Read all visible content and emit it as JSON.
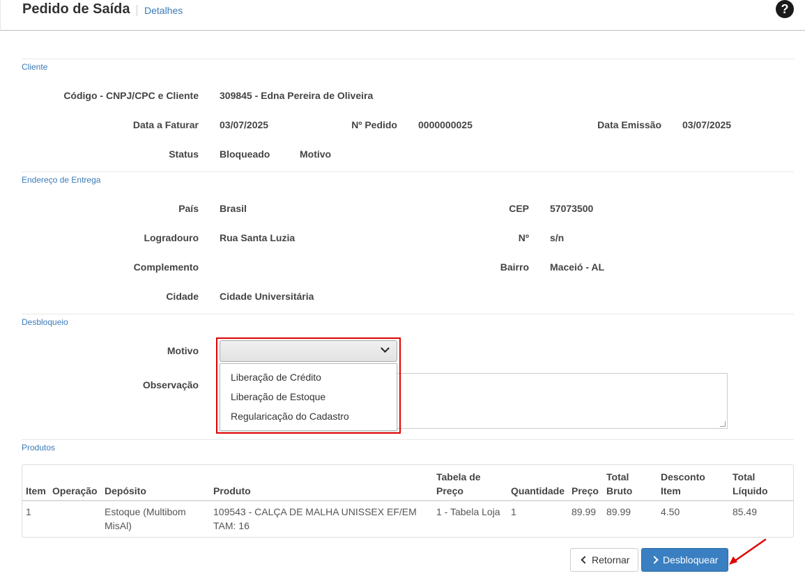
{
  "header": {
    "title": "Pedido de Saída",
    "breadcrumb": "Detalhes",
    "help_icon": "question-circle-icon"
  },
  "cliente": {
    "section_label": "Cliente",
    "codigo_label": "Código - CNPJ/CPC e Cliente",
    "codigo_value": "309845 - Edna Pereira de Oliveira",
    "data_faturar_label": "Data a Faturar",
    "data_faturar_value": "03/07/2025",
    "pedido_label": "Nº Pedido",
    "pedido_value": "0000000025",
    "data_emissao_label": "Data Emissão",
    "data_emissao_value": "03/07/2025",
    "status_label": "Status",
    "status_value": "Bloqueado",
    "motivo_label": "Motivo"
  },
  "endereco": {
    "section_label": "Endereço de Entrega",
    "pais_label": "País",
    "pais_value": "Brasil",
    "cep_label": "CEP",
    "cep_value": "57073500",
    "logradouro_label": "Logradouro",
    "logradouro_value": "Rua Santa Luzia",
    "numero_label": "Nº",
    "numero_value": "s/n",
    "complemento_label": "Complemento",
    "bairro_label": "Bairro",
    "bairro_value": "Maceió - AL",
    "cidade_label": "Cidade",
    "cidade_value": "Cidade Universitária"
  },
  "desbloqueio": {
    "section_label": "Desbloqueio",
    "motivo_label": "Motivo",
    "motivo_selected": "",
    "motivo_options": [
      "Liberação de Crédito",
      "Liberação de Estoque",
      "Regularicação do Cadastro"
    ],
    "observacao_label": "Observação",
    "observacao_value": ""
  },
  "produtos": {
    "section_label": "Produtos",
    "columns": {
      "item": "Item",
      "operacao": "Operação",
      "deposito": "Depósito",
      "produto": "Produto",
      "tabela_1": "Tabela de",
      "tabela_2": "Preço",
      "quantidade": "Quantidade",
      "preco": "Preço",
      "total_bruto_1": "Total",
      "total_bruto_2": "Bruto",
      "desconto_1": "Desconto",
      "desconto_2": "Item",
      "total_liquido_1": "Total",
      "total_liquido_2": "Líquido"
    },
    "rows": [
      {
        "item": "1",
        "operacao": "",
        "deposito_1": "Estoque (Multibom",
        "deposito_2": "MisAl)",
        "produto_1": "109543 - CALÇA DE MALHA UNISSEX EF/EM",
        "produto_2": "TAM: 16",
        "tabela": "1 - Tabela Loja",
        "quantidade": "1",
        "preco": "89.99",
        "total_bruto": "89.99",
        "desconto": "4.50",
        "total_liquido": "85.49"
      }
    ]
  },
  "actions": {
    "return_label": "Retornar",
    "unlock_label": "Desbloquear"
  },
  "colors": {
    "accent": "#3a7ab7",
    "highlight": "#e00000"
  }
}
